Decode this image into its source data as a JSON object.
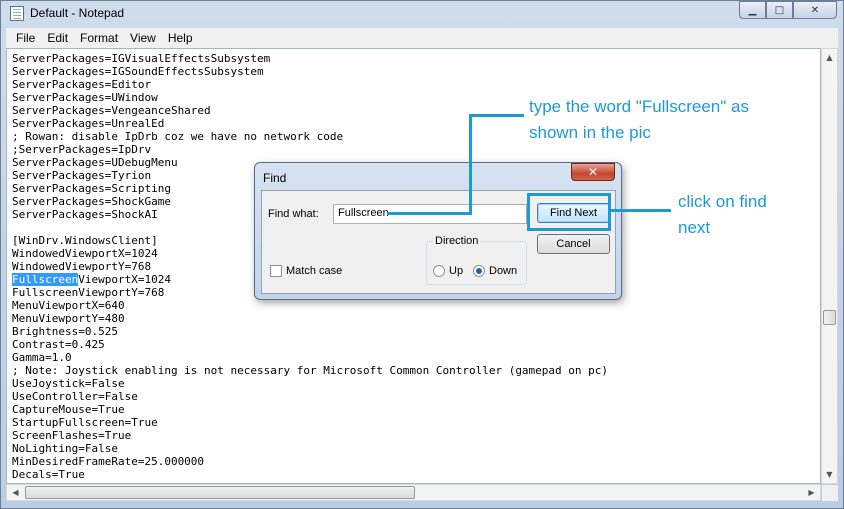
{
  "window": {
    "title": "Default - Notepad",
    "minimize_glyph": "▁",
    "maximize_glyph": "□",
    "close_glyph": "✕"
  },
  "menu": [
    "File",
    "Edit",
    "Format",
    "View",
    "Help"
  ],
  "editor": {
    "lines": [
      "ServerPackages=IGVisualEffectsSubsystem",
      "ServerPackages=IGSoundEffectsSubsystem",
      "ServerPackages=Editor",
      "ServerPackages=UWindow",
      "ServerPackages=VengeanceShared",
      "ServerPackages=UnrealEd",
      "; Rowan: disable IpDrb coz we have no network code",
      ";ServerPackages=IpDrv",
      "ServerPackages=UDebugMenu",
      "ServerPackages=Tyrion",
      "ServerPackages=Scripting",
      "ServerPackages=ShockGame",
      "ServerPackages=ShockAI",
      "",
      "[WinDrv.WindowsClient]",
      "WindowedViewportX=1024",
      "WindowedViewportY=768",
      "",
      "FullscreenViewportY=768",
      "MenuViewportX=640",
      "MenuViewportY=480",
      "Brightness=0.525",
      "Contrast=0.425",
      "Gamma=1.0",
      "; Note: Joystick enabling is not necessary for Microsoft Common Controller (gamepad on pc)",
      "UseJoystick=False",
      "UseController=False",
      "CaptureMouse=True",
      "StartupFullscreen=True",
      "ScreenFlashes=True",
      "NoLighting=False",
      "MinDesiredFrameRate=25.000000",
      "Decals=True"
    ],
    "highlight_line": {
      "selected": "Fullscreen",
      "rest": "ViewportX=1024"
    }
  },
  "find_dialog": {
    "title": "Find",
    "close_glyph": "✕",
    "find_what_label": "Find what:",
    "find_what_value": "Fullscreen",
    "find_next_label": "Find Next",
    "cancel_label": "Cancel",
    "match_case_label": "Match case",
    "direction_label": "Direction",
    "up_label": "Up",
    "down_label": "Down",
    "direction_selected": "Down",
    "match_case_checked": false
  },
  "annotations": {
    "type_word_line1": "type the word \"Fullscreen\" as",
    "type_word_line2": "shown in the pic",
    "click_find_line1": "click on find",
    "click_find_line2": "next",
    "accent_color": "#1c9ad6"
  },
  "scroll": {
    "up_glyph": "▲",
    "down_glyph": "▼",
    "left_glyph": "◀",
    "right_glyph": "▶"
  }
}
